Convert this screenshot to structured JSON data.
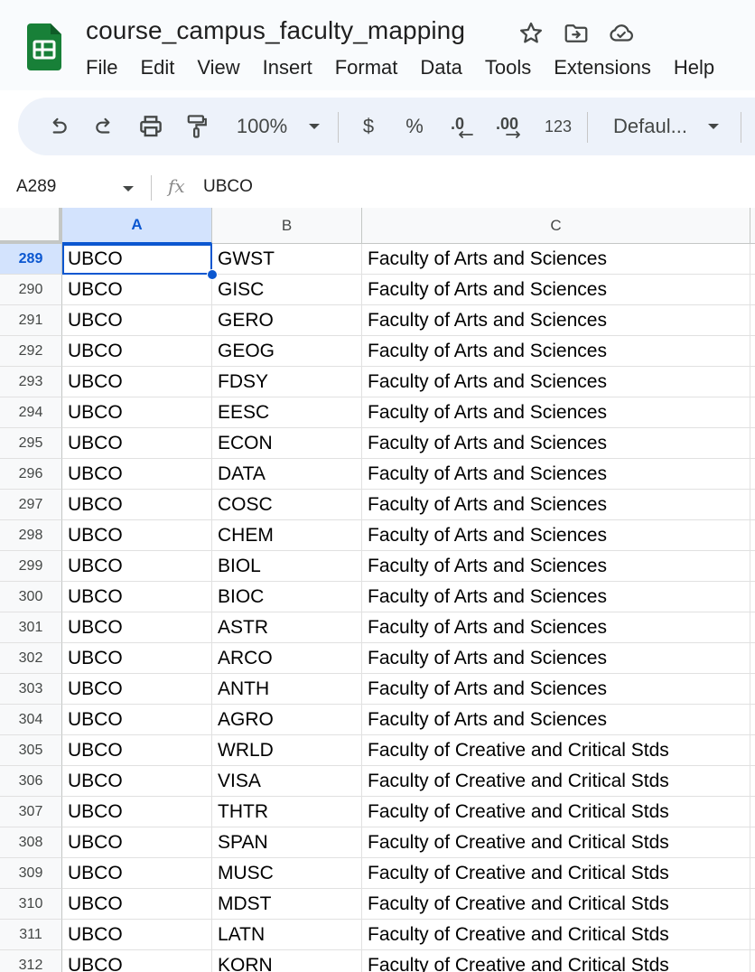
{
  "app": {
    "doc_title": "course_campus_faculty_mapping",
    "menu": [
      "File",
      "Edit",
      "View",
      "Insert",
      "Format",
      "Data",
      "Tools",
      "Extensions",
      "Help"
    ]
  },
  "toolbar": {
    "zoom": "100%",
    "currency": "$",
    "percent": "%",
    "decrease_decimal": ".0",
    "increase_decimal": ".00",
    "more_formats": "123",
    "font": "Defaul..."
  },
  "formula_bar": {
    "cell_ref": "A289",
    "fx": "fx",
    "value": "UBCO"
  },
  "columns": [
    "A",
    "B",
    "C"
  ],
  "active_column": "A",
  "rows": [
    {
      "num": "289",
      "a": "UBCO",
      "b": "GWST",
      "c": "Faculty of Arts and Sciences"
    },
    {
      "num": "290",
      "a": "UBCO",
      "b": "GISC",
      "c": "Faculty of Arts and Sciences"
    },
    {
      "num": "291",
      "a": "UBCO",
      "b": "GERO",
      "c": "Faculty of Arts and Sciences"
    },
    {
      "num": "292",
      "a": "UBCO",
      "b": "GEOG",
      "c": "Faculty of Arts and Sciences"
    },
    {
      "num": "293",
      "a": "UBCO",
      "b": "FDSY",
      "c": "Faculty of Arts and Sciences"
    },
    {
      "num": "294",
      "a": "UBCO",
      "b": "EESC",
      "c": "Faculty of Arts and Sciences"
    },
    {
      "num": "295",
      "a": "UBCO",
      "b": "ECON",
      "c": "Faculty of Arts and Sciences"
    },
    {
      "num": "296",
      "a": "UBCO",
      "b": "DATA",
      "c": "Faculty of Arts and Sciences"
    },
    {
      "num": "297",
      "a": "UBCO",
      "b": "COSC",
      "c": "Faculty of Arts and Sciences"
    },
    {
      "num": "298",
      "a": "UBCO",
      "b": "CHEM",
      "c": "Faculty of Arts and Sciences"
    },
    {
      "num": "299",
      "a": "UBCO",
      "b": "BIOL",
      "c": "Faculty of Arts and Sciences"
    },
    {
      "num": "300",
      "a": "UBCO",
      "b": "BIOC",
      "c": "Faculty of Arts and Sciences"
    },
    {
      "num": "301",
      "a": "UBCO",
      "b": "ASTR",
      "c": "Faculty of Arts and Sciences"
    },
    {
      "num": "302",
      "a": "UBCO",
      "b": "ARCO",
      "c": "Faculty of Arts and Sciences"
    },
    {
      "num": "303",
      "a": "UBCO",
      "b": "ANTH",
      "c": "Faculty of Arts and Sciences"
    },
    {
      "num": "304",
      "a": "UBCO",
      "b": "AGRO",
      "c": "Faculty of Arts and Sciences"
    },
    {
      "num": "305",
      "a": "UBCO",
      "b": "WRLD",
      "c": "Faculty of Creative and Critical Stds"
    },
    {
      "num": "306",
      "a": "UBCO",
      "b": "VISA",
      "c": "Faculty of Creative and Critical Stds"
    },
    {
      "num": "307",
      "a": "UBCO",
      "b": "THTR",
      "c": "Faculty of Creative and Critical Stds"
    },
    {
      "num": "308",
      "a": "UBCO",
      "b": "SPAN",
      "c": "Faculty of Creative and Critical Stds"
    },
    {
      "num": "309",
      "a": "UBCO",
      "b": "MUSC",
      "c": "Faculty of Creative and Critical Stds"
    },
    {
      "num": "310",
      "a": "UBCO",
      "b": "MDST",
      "c": "Faculty of Creative and Critical Stds"
    },
    {
      "num": "311",
      "a": "UBCO",
      "b": "LATN",
      "c": "Faculty of Creative and Critical Stds"
    },
    {
      "num": "312",
      "a": "UBCO",
      "b": "KORN",
      "c": "Faculty of Creative and Critical Stds"
    }
  ],
  "active_row": "289",
  "colors": {
    "accent": "#0b57d0",
    "selection_fill": "#d3e3fd",
    "toolbar_bg": "#edf2fa",
    "sheets_green": "#188038"
  },
  "icons": {
    "logo": "google-sheets-logo",
    "star": "star-icon",
    "move": "move-to-folder-icon",
    "cloud": "cloud-saved-icon",
    "undo": "undo-icon",
    "redo": "redo-icon",
    "print": "print-icon",
    "paint_format": "paint-format-icon",
    "dropdown": "chevron-down-icon"
  }
}
